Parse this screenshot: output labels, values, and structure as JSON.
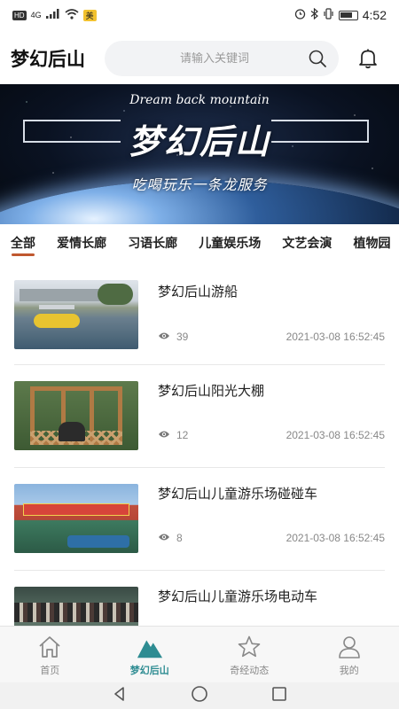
{
  "status_bar": {
    "hd": "HD",
    "network": "4G",
    "app_badge": "美",
    "time": "4:52"
  },
  "header": {
    "title": "梦幻后山",
    "search_placeholder": "请输入关键词"
  },
  "banner": {
    "english": "Dream back mountain",
    "title": "梦幻后山",
    "slogan": "吃喝玩乐一条龙服务"
  },
  "categories": [
    {
      "label": "全部",
      "active": true
    },
    {
      "label": "爱情长廊",
      "active": false
    },
    {
      "label": "习语长廊",
      "active": false
    },
    {
      "label": "儿童娱乐场",
      "active": false
    },
    {
      "label": "文艺会演",
      "active": false
    },
    {
      "label": "植物园",
      "active": false
    }
  ],
  "items": [
    {
      "title": "梦幻后山游船",
      "views": "39",
      "date": "2021-03-08 16:52:45"
    },
    {
      "title": "梦幻后山阳光大棚",
      "views": "12",
      "date": "2021-03-08 16:52:45"
    },
    {
      "title": "梦幻后山儿童游乐场碰碰车",
      "views": "8",
      "date": "2021-03-08 16:52:45"
    },
    {
      "title": "梦幻后山儿童游乐场电动车",
      "views": "",
      "date": ""
    }
  ],
  "bottom_nav": [
    {
      "label": "首页",
      "icon": "home-icon",
      "active": false
    },
    {
      "label": "梦幻后山",
      "icon": "mountain-icon",
      "active": true
    },
    {
      "label": "奇经动态",
      "icon": "star-icon",
      "active": false
    },
    {
      "label": "我的",
      "icon": "user-icon",
      "active": false
    }
  ],
  "colors": {
    "accent": "#2e8c92",
    "category_underline": "#c0582f"
  }
}
